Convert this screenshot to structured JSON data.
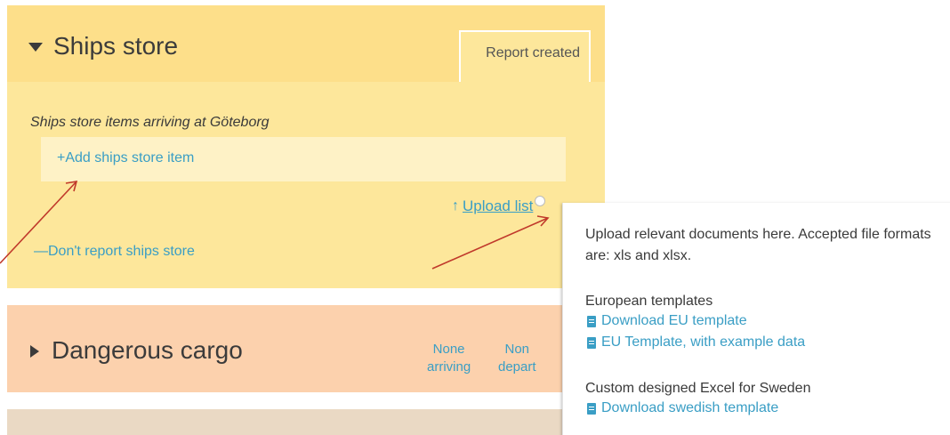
{
  "ships_store": {
    "title": "Ships store",
    "tab_label": "Report created",
    "items_heading": "Ships store items arriving at Göteborg",
    "add_item_label": "+Add ships store item",
    "upload_label": "Upload list",
    "dont_report_label": "—Don't report ships store"
  },
  "dangerous_cargo": {
    "title": "Dangerous cargo",
    "arriving_line1": "None",
    "arriving_line2": "arriving",
    "departing_line1": "Non",
    "departing_line2": "depart"
  },
  "tooltip": {
    "description": "Upload relevant documents here. Accepted file formats are: xls and xlsx.",
    "european_heading": "European templates",
    "eu_template_label": "Download EU template",
    "eu_example_label": "EU Template, with example data",
    "custom_heading": "Custom designed Excel for Sweden",
    "swedish_template_label": "Download swedish template"
  },
  "colors": {
    "ships_panel": "#fde79b",
    "danger_panel": "#fcd1ad",
    "link": "#3a9ec5",
    "annotation_arrow": "#c0392b"
  },
  "icons": {
    "expand": "triangle-down-icon",
    "collapsed": "triangle-right-icon",
    "upload": "arrow-up-icon",
    "info": "info-icon",
    "document": "document-icon"
  }
}
